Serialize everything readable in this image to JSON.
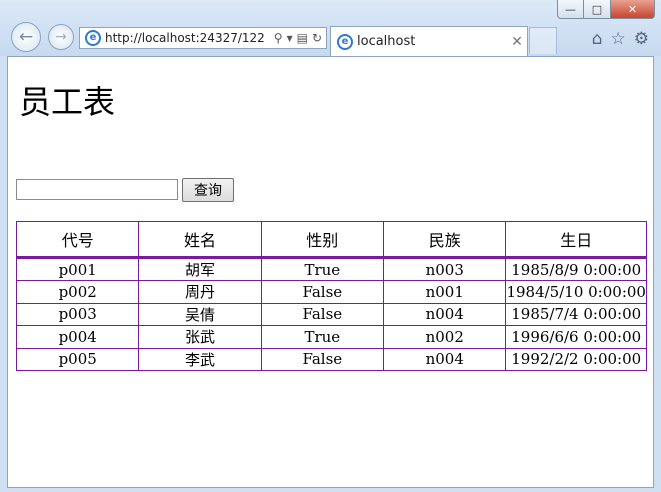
{
  "window": {
    "minimize_icon": "minimize-icon",
    "maximize_icon": "maximize-icon",
    "close_icon": "close-icon"
  },
  "browser": {
    "address_url": "http://localhost:24327/122",
    "tab_title": "localhost",
    "tab_close": "✕",
    "icons": [
      "back-arrow-icon",
      "forward-arrow-icon",
      "search-icon",
      "dropdown-icon",
      "compatibility-icon",
      "refresh-icon",
      "home-icon",
      "favorites-star-icon",
      "settings-gear-icon"
    ]
  },
  "page": {
    "title": "员工表",
    "search": {
      "value": "",
      "button_label": "查询"
    },
    "table": {
      "headers": [
        "代号",
        "姓名",
        "性别",
        "民族",
        "生日"
      ],
      "rows": [
        [
          "p001",
          "胡军",
          "True",
          "n003",
          "1985/8/9 0:00:00"
        ],
        [
          "p002",
          "周丹",
          "False",
          "n001",
          "1984/5/10 0:00:00"
        ],
        [
          "p003",
          "吴倩",
          "False",
          "n004",
          "1985/7/4 0:00:00"
        ],
        [
          "p004",
          "张武",
          "True",
          "n002",
          "1996/6/6 0:00:00"
        ],
        [
          "p005",
          "李武",
          "False",
          "n004",
          "1992/2/2 0:00:00"
        ]
      ],
      "border_color": "#7a1aa0"
    }
  }
}
